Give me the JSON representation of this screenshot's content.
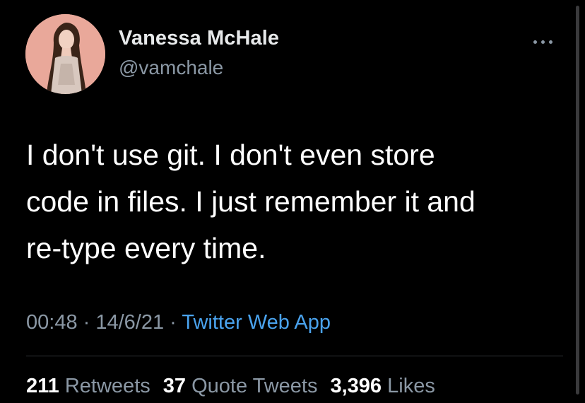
{
  "user": {
    "display_name": "Vanessa McHale",
    "handle": "@vamchale",
    "avatar_bg": "#e9a89a"
  },
  "tweet": {
    "text": "I don't use git. I don't even store\ncode in files. I just remember it and\nre-type every time.",
    "time": "00:48",
    "separator": " · ",
    "date": "14/6/21",
    "source": "Twitter Web App"
  },
  "stats": {
    "retweets_count": "211",
    "retweets_label": "Retweets",
    "quotes_count": "37",
    "quotes_label": "Quote Tweets",
    "likes_count": "3,396",
    "likes_label": "Likes"
  },
  "icons": {
    "more": "more-horizontal-icon"
  },
  "colors": {
    "background": "#000000",
    "text": "#ffffff",
    "secondary": "#8b98a5",
    "link": "#4aa3ee"
  }
}
